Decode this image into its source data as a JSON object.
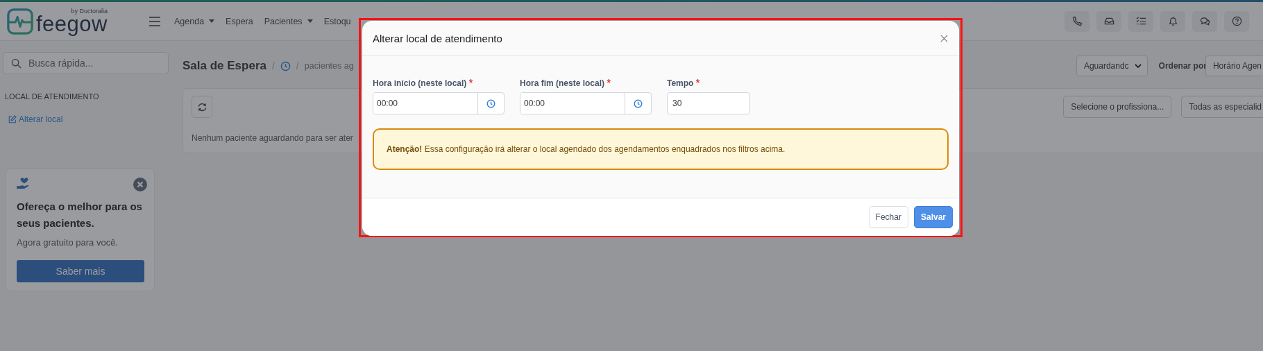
{
  "header": {
    "logo_text": "feegow",
    "logo_byline": "by Doctoralia",
    "nav": [
      {
        "label": "Agenda",
        "dropdown": true
      },
      {
        "label": "Espera",
        "dropdown": false
      },
      {
        "label": "Pacientes",
        "dropdown": true
      },
      {
        "label": "Estoqu",
        "dropdown": false
      }
    ]
  },
  "sidebar": {
    "search_placeholder": "Busca rápida...",
    "section_title": "LOCAL DE ATENDIMENTO",
    "link": "Alterar local",
    "promo": {
      "title": "Ofereça o melhor para os seus pacientes.",
      "subtitle": "Agora gratuito para você.",
      "button": "Saber mais"
    }
  },
  "page": {
    "title": "Sala de Espera",
    "separators": [
      "/",
      "/"
    ],
    "breadcrumb": "pacientes ag",
    "status_select": "Aguardandc",
    "sort_label": "Ordenar por",
    "sort_select": "Horário Agen",
    "filters": [
      "Selecione o profissiona...",
      "Todas as especialid"
    ],
    "empty_message": "Nenhum paciente aguardando para ser ater"
  },
  "modal": {
    "title": "Alterar local de atendimento",
    "fields": [
      {
        "label": "Hora início (neste local)",
        "required_mark": "*",
        "value": "00:00",
        "kind": "time"
      },
      {
        "label": "Hora fim (neste local)",
        "required_mark": "*",
        "value": "00:00",
        "kind": "time"
      },
      {
        "label": "Tempo",
        "required_mark": "*",
        "value": "30",
        "kind": "number"
      }
    ],
    "alert": "**Atenção!** Essa configuração irá alterar o local agendado dos agendamentos enquadrados nos filtros acima.",
    "buttons": [
      {
        "label": "Fechar",
        "kind": "secondary"
      },
      {
        "label": "Salvar",
        "kind": "primary"
      }
    ]
  }
}
